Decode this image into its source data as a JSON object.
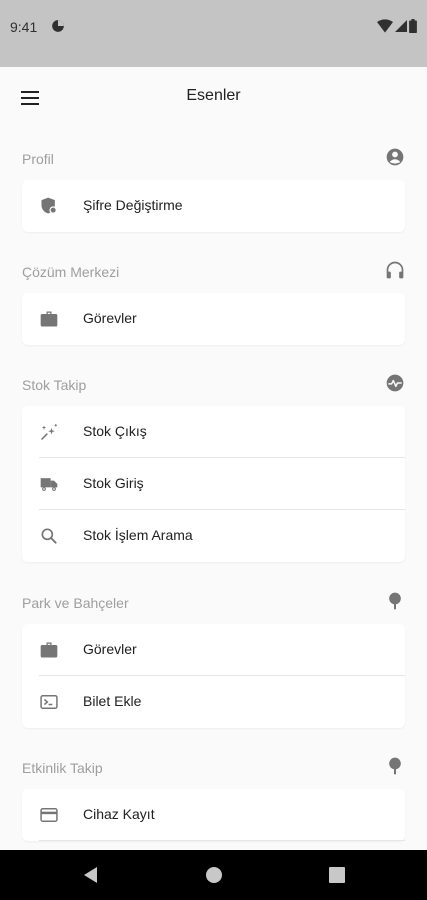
{
  "status_bar": {
    "time": "9:41"
  },
  "app_bar": {
    "title": "Esenler"
  },
  "sections": [
    {
      "title": "Profil",
      "icon": "account-circle-icon",
      "items": [
        {
          "label": "Şifre Değiştirme",
          "icon": "security-icon"
        }
      ]
    },
    {
      "title": "Çözüm Merkezi",
      "icon": "headphones-icon",
      "items": [
        {
          "label": "Görevler",
          "icon": "briefcase-icon"
        }
      ]
    },
    {
      "title": "Stok Takip",
      "icon": "monitor-heart-icon",
      "items": [
        {
          "label": "Stok Çıkış",
          "icon": "auto-awesome-icon"
        },
        {
          "label": "Stok Giriş",
          "icon": "local-shipping-icon"
        },
        {
          "label": "Stok İşlem Arama",
          "icon": "search-icon"
        }
      ]
    },
    {
      "title": "Park ve Bahçeler",
      "icon": "tree-icon",
      "items": [
        {
          "label": "Görevler",
          "icon": "briefcase-icon"
        },
        {
          "label": "Bilet Ekle",
          "icon": "terminal-icon"
        }
      ]
    },
    {
      "title": "Etkinlik Takip",
      "icon": "tree-icon",
      "items": [
        {
          "label": "Cihaz Kayıt",
          "icon": "credit-card-icon"
        }
      ]
    }
  ],
  "colors": {
    "status_bar_bg": "#c4c4c4",
    "page_bg": "#fafafa",
    "card_bg": "#ffffff",
    "section_title": "#9e9e9e",
    "icon": "#757575",
    "nav_bar_bg": "#000000"
  }
}
